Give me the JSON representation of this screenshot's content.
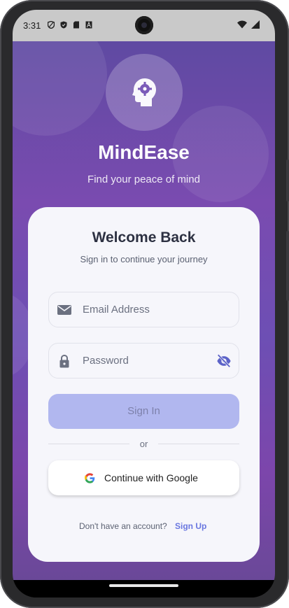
{
  "status_bar": {
    "time": "3:31",
    "icons": [
      "shield-icon",
      "shield-check-icon",
      "sd-card-icon",
      "font-icon"
    ],
    "right_icons": [
      "wifi-icon",
      "signal-icon"
    ]
  },
  "app": {
    "name": "MindEase",
    "tagline": "Find your peace of mind",
    "logo_icon": "head-gear-icon"
  },
  "card": {
    "title": "Welcome Back",
    "subtitle": "Sign in to continue your journey",
    "email": {
      "placeholder": "Email Address",
      "icon": "mail-icon"
    },
    "password": {
      "placeholder": "Password",
      "icon": "lock-icon",
      "toggle_icon": "eye-off-icon"
    },
    "signin_label": "Sign In",
    "or_label": "or",
    "google_label": "Continue with Google",
    "footer_text": "Don't have an account?",
    "signup_label": "Sign Up"
  },
  "colors": {
    "background_gradient": [
      "#5f4aa2",
      "#7c46ab"
    ],
    "card": "#f6f6fb",
    "signin_button": "#b1b7ef",
    "link": "#6a77e0"
  }
}
